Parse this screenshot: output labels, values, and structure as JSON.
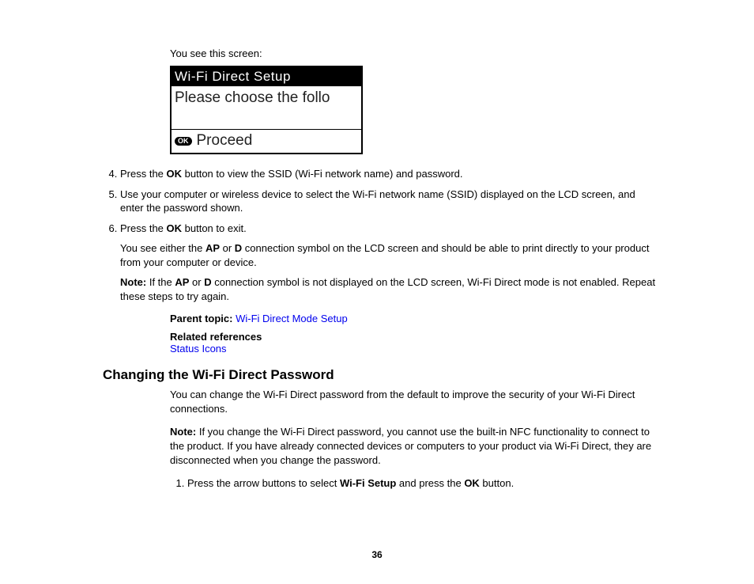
{
  "intro": "You see this screen:",
  "lcd": {
    "title": "Wi-Fi Direct Setup",
    "body": "Please choose the follo",
    "ok_label": "OK",
    "proceed": "Proceed"
  },
  "steps": {
    "s4_a": "Press the ",
    "s4_b": "OK",
    "s4_c": " button to view the SSID (Wi-Fi network name) and password.",
    "s5": "Use your computer or wireless device to select the Wi-Fi network name (SSID) displayed on the LCD screen, and enter the password shown.",
    "s6_a": "Press the ",
    "s6_b": "OK",
    "s6_c": " button to exit.",
    "s6_sub_a": "You see either the ",
    "s6_sub_b": "AP",
    "s6_sub_c": " or ",
    "s6_sub_d": "D",
    "s6_sub_e": " connection symbol on the LCD screen and should be able to print directly to your product from your computer or device.",
    "s6_note_a": "Note:",
    "s6_note_b": " If the ",
    "s6_note_c": "AP",
    "s6_note_d": " or ",
    "s6_note_e": "D",
    "s6_note_f": " connection symbol is not displayed on the LCD screen, Wi-Fi Direct mode is not enabled. Repeat these steps to try again."
  },
  "parent_topic_label": "Parent topic:",
  "parent_topic_link": "Wi-Fi Direct Mode Setup",
  "related_label": "Related references",
  "related_link": "Status Icons",
  "heading2": "Changing the Wi-Fi Direct Password",
  "section": {
    "p1": "You can change the Wi-Fi Direct password from the default to improve the security of your Wi-Fi Direct connections.",
    "note_a": "Note:",
    "note_b": " If you change the Wi-Fi Direct password, you cannot use the built-in NFC functionality to connect to the product. If you have already connected devices or computers to your product via Wi-Fi Direct, they are disconnected when you change the password.",
    "step1_a": "Press the arrow buttons to select ",
    "step1_b": "Wi-Fi Setup",
    "step1_c": " and press the ",
    "step1_d": "OK",
    "step1_e": " button."
  },
  "page_number": "36"
}
